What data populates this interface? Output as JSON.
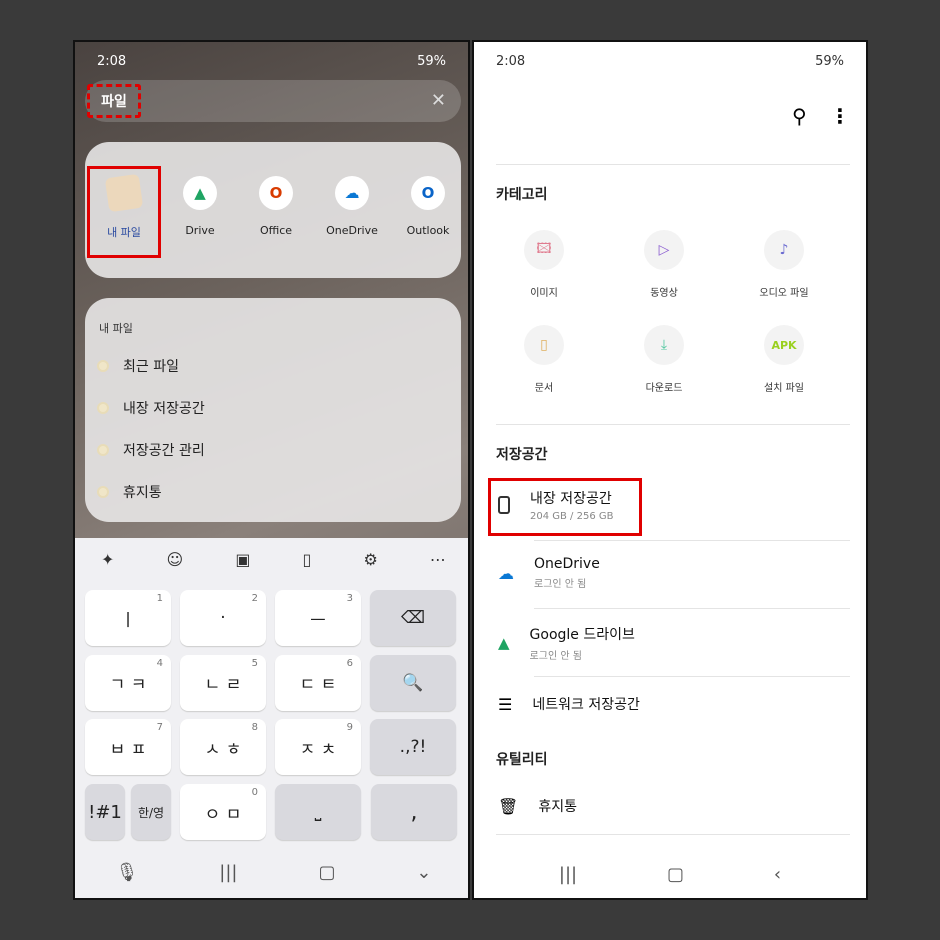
{
  "left": {
    "status": {
      "time": "2:08",
      "battery": "59%"
    },
    "search": {
      "query": "파일"
    },
    "apps": [
      {
        "label": "내 파일",
        "icon": "folder-icon"
      },
      {
        "label": "Drive",
        "icon": "google-drive-icon"
      },
      {
        "label": "Office",
        "icon": "office-icon"
      },
      {
        "label": "OneDrive",
        "icon": "onedrive-icon"
      },
      {
        "label": "Outlook",
        "icon": "outlook-icon"
      }
    ],
    "shortcuts": {
      "title": "내 파일",
      "items": [
        "최근 파일",
        "내장 저장공간",
        "저장공간 관리",
        "휴지통"
      ]
    },
    "keyboard": {
      "rows": [
        [
          {
            "k": "ㅣ",
            "n": "1"
          },
          {
            "k": "·",
            "n": "2"
          },
          {
            "k": "ㅡ",
            "n": "3"
          },
          {
            "k": "⌫",
            "n": ""
          }
        ],
        [
          {
            "k": "ㄱ ㅋ",
            "n": "4"
          },
          {
            "k": "ㄴ ㄹ",
            "n": "5"
          },
          {
            "k": "ㄷ ㅌ",
            "n": "6"
          },
          {
            "k": "🔍",
            "n": ""
          }
        ],
        [
          {
            "k": "ㅂ ㅍ",
            "n": "7"
          },
          {
            "k": "ㅅ ㅎ",
            "n": "8"
          },
          {
            "k": "ㅈ ㅊ",
            "n": "9"
          },
          {
            "k": ".,?!",
            "n": ""
          }
        ]
      ],
      "bottom": {
        "sym": "!#1",
        "lang": "한/영",
        "key0": "ㅇ ㅁ",
        "n0": "0",
        "space": "⎵",
        "comma": ","
      }
    }
  },
  "right": {
    "status": {
      "time": "2:08",
      "battery": "59%"
    },
    "category_title": "카테고리",
    "categories": [
      {
        "label": "이미지",
        "color": "#e07a8e"
      },
      {
        "label": "동영상",
        "color": "#8a5bd0"
      },
      {
        "label": "오디오 파일",
        "color": "#6a6ad0"
      },
      {
        "label": "문서",
        "color": "#e0b060"
      },
      {
        "label": "다운로드",
        "color": "#50c8a0"
      },
      {
        "label": "설치 파일",
        "color": "#9ad020",
        "text": "APK"
      }
    ],
    "storage_title": "저장공간",
    "storage": [
      {
        "name": "내장 저장공간",
        "sub": "204 GB / 256 GB"
      },
      {
        "name": "OneDrive",
        "sub": "로그인 안 됨"
      },
      {
        "name": "Google 드라이브",
        "sub": "로그인 안 됨"
      },
      {
        "name": "네트워크 저장공간",
        "sub": ""
      }
    ],
    "utility_title": "유틸리티",
    "utility": [
      {
        "name": "휴지통"
      }
    ]
  },
  "highlight_color": "#e00000"
}
